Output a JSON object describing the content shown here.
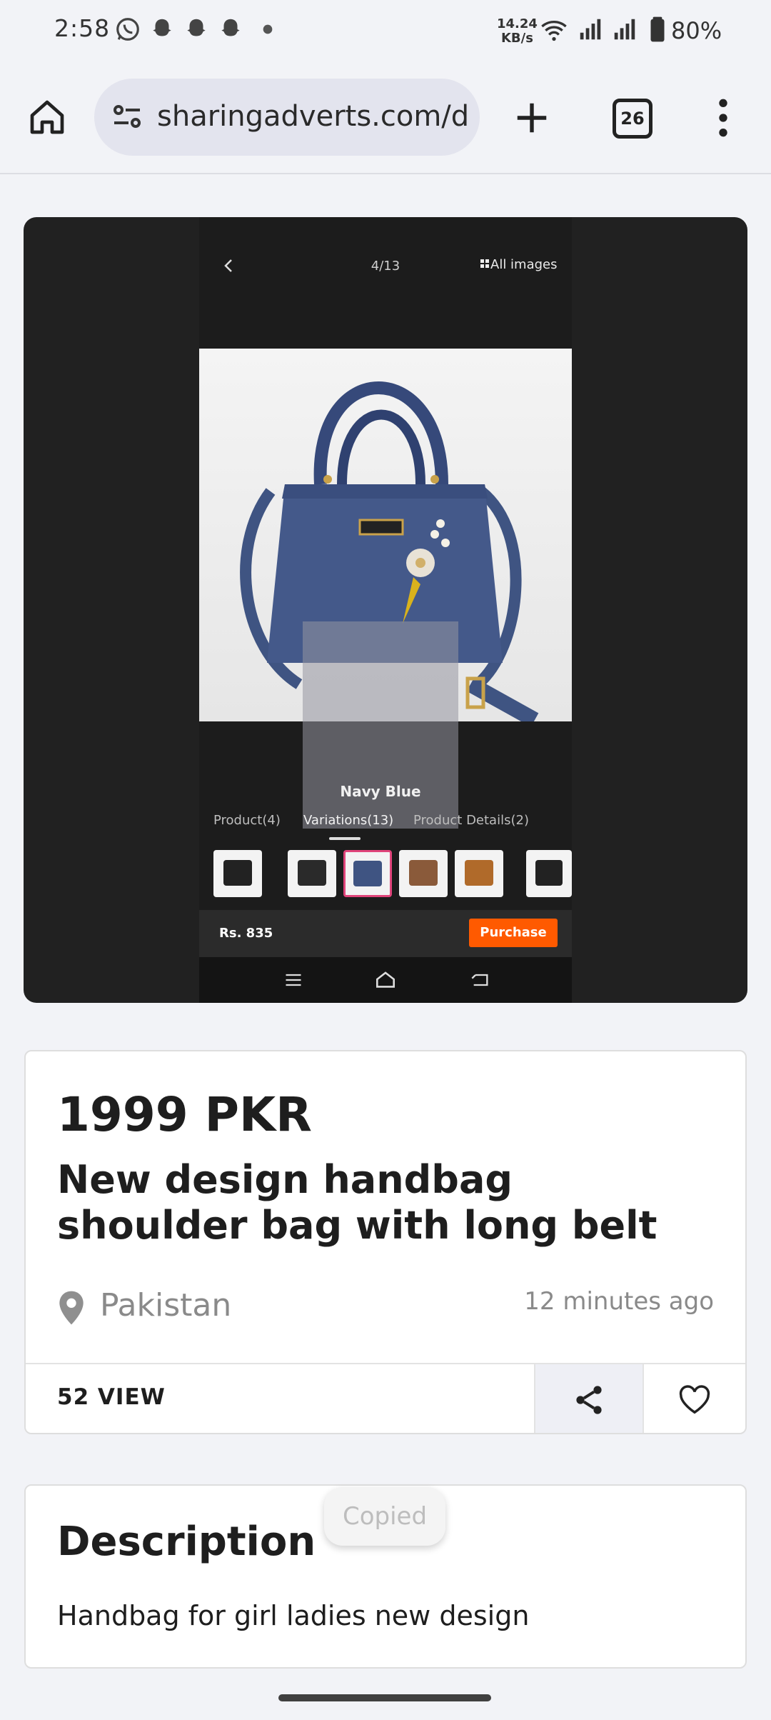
{
  "status_bar": {
    "time": "2:58",
    "net_speed_value": "14.24",
    "net_speed_unit": "KB/s",
    "battery": "80%",
    "notification_icons": [
      "whatsapp-icon",
      "snapchat-icon",
      "snapchat-icon",
      "snapchat-icon",
      "dot-icon"
    ]
  },
  "browser": {
    "url": "sharingadverts.com/d",
    "tab_count": "26"
  },
  "gallery": {
    "counter": "4/13",
    "all_images": "All images",
    "tabs": [
      "Product(4)",
      "Variations(13)",
      "Product Details(2)"
    ],
    "variation_label": "Navy Blue",
    "price": "Rs. 835",
    "purchase": "Purchase"
  },
  "product": {
    "price": "1999 PKR",
    "title": "New design handbag shoulder bag with long belt",
    "location": "Pakistan",
    "time_ago": "12 minutes ago",
    "views": "52 VIEW"
  },
  "description": {
    "heading": "Description",
    "text": "Handbag for girl ladies new design"
  },
  "toast": "Copied",
  "colors": {
    "accent_orange": "#ff5a00",
    "bag_blue": "#3f5482",
    "background": "#f2f3f7"
  }
}
